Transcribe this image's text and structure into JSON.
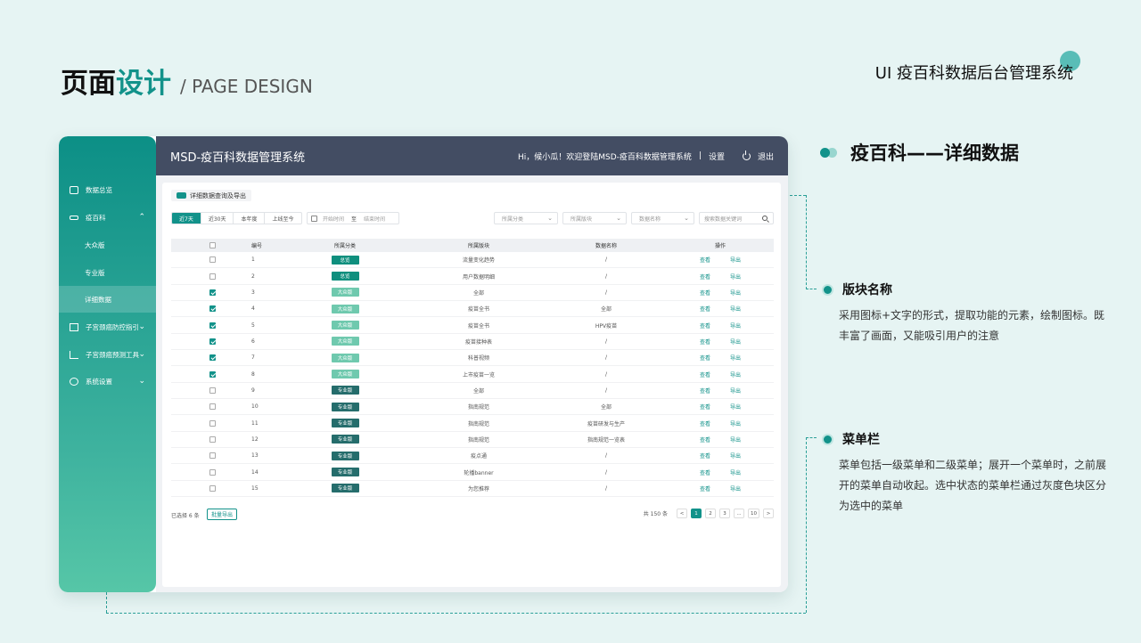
{
  "slide": {
    "title_a": "页面",
    "title_b": "设计",
    "title_en": "/ PAGE DESIGN",
    "top_right": "UI  疫百科数据后台管理系统"
  },
  "app": {
    "title": "MSD-疫百科数据管理系统",
    "greeting": "Hi，候小瓜！欢迎登陆MSD-疫百科数据管理系统",
    "sep": "|",
    "settings": "设置",
    "logout": "退出"
  },
  "sidebar": {
    "items": [
      {
        "label": "数据总览",
        "icon": "monitor-icon"
      },
      {
        "label": "疫百科",
        "icon": "card-icon",
        "chevron": "⌃"
      },
      {
        "label": "大众版"
      },
      {
        "label": "专业版"
      },
      {
        "label": "详细数据"
      },
      {
        "label": "子宫颈癌防控指引",
        "icon": "signpost-icon",
        "chevron": "⌄"
      },
      {
        "label": "子宫颈癌预测工具",
        "icon": "chart-icon",
        "chevron": "⌄"
      },
      {
        "label": "系统设置",
        "icon": "gear-icon",
        "chevron": "⌄"
      }
    ]
  },
  "section_tab": "详细数据查询及导出",
  "filters": {
    "periods": [
      "近7天",
      "近30天",
      "本年度",
      "上线至今"
    ],
    "start_placeholder": "开始时间",
    "to": "至",
    "end_placeholder": "结束时间",
    "category_placeholder": "所属分类",
    "section_placeholder": "所属版块",
    "name_placeholder": "数据名称",
    "search_placeholder": "搜索数据关键词"
  },
  "table": {
    "headers": [
      "编号",
      "所属分类",
      "所属版块",
      "数据名称",
      "操作"
    ],
    "rows": [
      {
        "checked": false,
        "no": "1",
        "cat": "总览",
        "ct": 0,
        "sec": "流量变化趋势",
        "name": "/"
      },
      {
        "checked": false,
        "no": "2",
        "cat": "总览",
        "ct": 0,
        "sec": "用户数据明细",
        "name": "/"
      },
      {
        "checked": true,
        "no": "3",
        "cat": "大众版",
        "ct": 1,
        "sec": "全部",
        "name": "/"
      },
      {
        "checked": true,
        "no": "4",
        "cat": "大众版",
        "ct": 1,
        "sec": "疫苗全书",
        "name": "全部"
      },
      {
        "checked": true,
        "no": "5",
        "cat": "大众版",
        "ct": 1,
        "sec": "疫苗全书",
        "name": "HPV疫苗"
      },
      {
        "checked": true,
        "no": "6",
        "cat": "大众版",
        "ct": 1,
        "sec": "疫苗接种表",
        "name": "/"
      },
      {
        "checked": true,
        "no": "7",
        "cat": "大众版",
        "ct": 1,
        "sec": "科普视频",
        "name": "/"
      },
      {
        "checked": true,
        "no": "8",
        "cat": "大众版",
        "ct": 1,
        "sec": "上市疫苗一览",
        "name": "/"
      },
      {
        "checked": false,
        "no": "9",
        "cat": "专业版",
        "ct": 2,
        "sec": "全部",
        "name": "/"
      },
      {
        "checked": false,
        "no": "10",
        "cat": "专业版",
        "ct": 2,
        "sec": "指南规范",
        "name": "全部"
      },
      {
        "checked": false,
        "no": "11",
        "cat": "专业版",
        "ct": 2,
        "sec": "指南规范",
        "name": "疫苗研发与生产"
      },
      {
        "checked": false,
        "no": "12",
        "cat": "专业版",
        "ct": 2,
        "sec": "指南规范",
        "name": "指南规范一览表"
      },
      {
        "checked": false,
        "no": "13",
        "cat": "专业版",
        "ct": 2,
        "sec": "疫点通",
        "name": "/"
      },
      {
        "checked": false,
        "no": "14",
        "cat": "专业版",
        "ct": 2,
        "sec": "轮播banner",
        "name": "/"
      },
      {
        "checked": false,
        "no": "15",
        "cat": "专业版",
        "ct": 2,
        "sec": "为您推荐",
        "name": "/"
      }
    ],
    "op_view": "查看",
    "op_export": "导出"
  },
  "footer": {
    "selected": "已选择 6 条",
    "bulk_export": "批量导出",
    "total": "共 150 条",
    "prev": "<",
    "pages": [
      "1",
      "2",
      "3",
      "...",
      "10"
    ],
    "next": ">"
  },
  "annotations": {
    "heading": "疫百科——详细数据",
    "block1_title": "版块名称",
    "block1_text": "采用图标+文字的形式，提取功能的元素，绘制图标。既丰富了画面，又能吸引用户的注意",
    "block2_title": "菜单栏",
    "block2_text": "菜单包括一级菜单和二级菜单；展开一个菜单时，之前展开的菜单自动收起。选中状态的菜单栏通过灰度色块区分为选中的菜单"
  },
  "colors": {
    "accent": "#12928a",
    "topbar": "#434d63",
    "page_bg": "#e6f4f3"
  }
}
